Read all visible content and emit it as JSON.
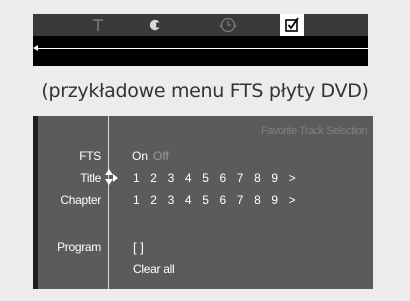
{
  "topbar": {
    "tabs": [
      {
        "icon": "t-icon"
      },
      {
        "icon": "c-icon"
      },
      {
        "icon": "clock-icon"
      },
      {
        "icon": "checkbox-icon",
        "selected": true
      }
    ]
  },
  "caption": "(przykładowe menu FTS płyty DVD)",
  "fts": {
    "header": "Favorite Track Selection",
    "labels": {
      "fts": "FTS",
      "title": "Title",
      "chapter": "Chapter",
      "program": "Program"
    },
    "on": "On",
    "off": "Off",
    "title_numbers": [
      "1",
      "2",
      "3",
      "4",
      "5",
      "6",
      "7",
      "8",
      "9",
      ">"
    ],
    "chapter_numbers": [
      "1",
      "2",
      "3",
      "4",
      "5",
      "6",
      "7",
      "8",
      "9",
      ">"
    ],
    "program_slot": "[ ]",
    "clear_all": "Clear all"
  },
  "colors": {
    "screen_bg": "#5b5b5b",
    "page_bg": "#ececec",
    "inactive_text": "#9a9a9a"
  }
}
